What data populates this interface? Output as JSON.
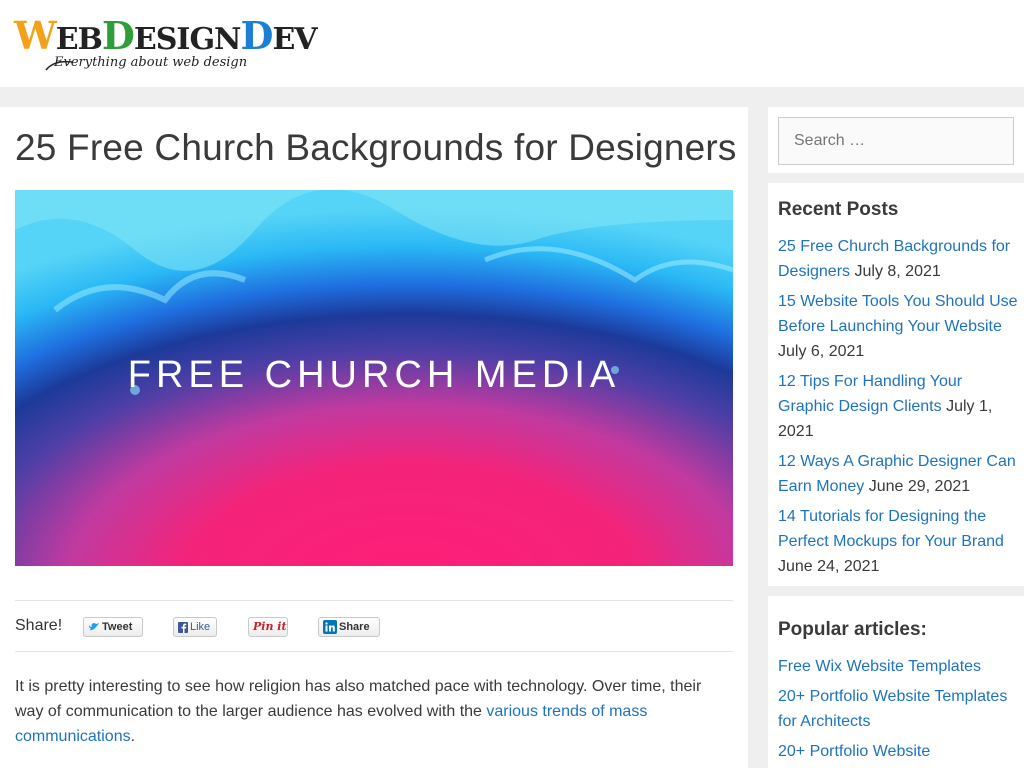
{
  "header": {
    "logo_parts": [
      "W",
      "EB",
      "D",
      "ESIGN",
      "D",
      "EV"
    ],
    "tagline": "Everything about web design"
  },
  "article": {
    "title": "25 Free Church Backgrounds for Designers",
    "hero_text": "FREE CHURCH MEDIA",
    "share_label": "Share!",
    "share_buttons": {
      "tweet": "Tweet",
      "like": "Like",
      "pin": "Pin it",
      "share": "Share"
    },
    "intro_text": "It is pretty interesting to see how religion has also matched pace with technology. Over time, their way of communication to the larger audience has evolved with the ",
    "intro_link": "various trends of mass communications",
    "intro_end": "."
  },
  "sidebar": {
    "search_placeholder": "Search …",
    "recent_title": "Recent Posts",
    "recent_posts": [
      {
        "title": "25 Free Church Backgrounds for Designers",
        "date": "July 8, 2021"
      },
      {
        "title": "15 Website Tools You Should Use Before Launching Your Website",
        "date": "July 6, 2021"
      },
      {
        "title": "12 Tips For Handling Your Graphic Design Clients",
        "date": "July 1, 2021"
      },
      {
        "title": "12 Ways A Graphic Designer Can Earn Money",
        "date": "June 29, 2021"
      },
      {
        "title": "14 Tutorials for Designing the Perfect Mockups for Your Brand",
        "date": "June 24, 2021"
      }
    ],
    "popular_title": "Popular articles:",
    "popular_posts": [
      {
        "title": "Free Wix Website Templates"
      },
      {
        "title": "20+ Portfolio Website Templates for Architects"
      },
      {
        "title": "20+ Portfolio Website"
      }
    ]
  },
  "colors": {
    "link": "#1e73be",
    "text": "#3a3a3a",
    "background": "#efefef"
  }
}
